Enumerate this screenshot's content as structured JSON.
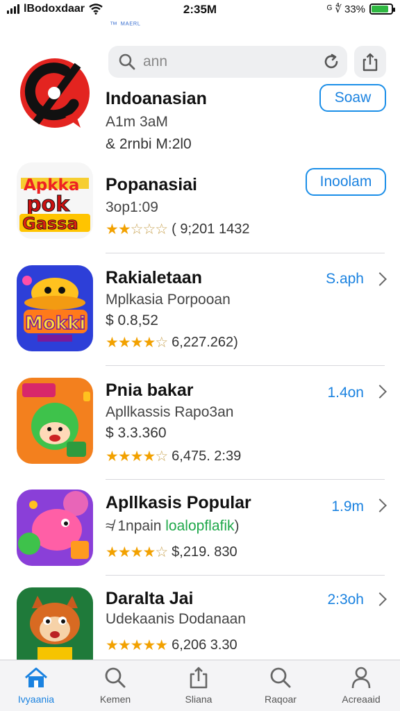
{
  "status_bar": {
    "carrier": "lBodoxdaar",
    "time": "2:35M",
    "right_text": "ᴳ ∜ 33%",
    "battery_level": 0.85,
    "sub_text": "™ ᴹᴬᴱᴿᴸ"
  },
  "search": {
    "value": "ann",
    "placeholder": "ann"
  },
  "apps": [
    {
      "name": "Indoanasian",
      "subtitle": "A1m 3aM",
      "meta": "& 2rnbi M:2l0",
      "action_label": "Soaw"
    },
    {
      "name": "Popanasiai",
      "subtitle": "3op1:09",
      "rating_text": "( 9;201 1432",
      "stars": 2.5,
      "action_label": "Inoolam"
    },
    {
      "name": "Rakialetaan",
      "subtitle": "Mplkasia Porpooan",
      "meta": "$ 0.8,52",
      "rating_text": "6,227.262)",
      "stars": 4.5,
      "size": "S.aph"
    },
    {
      "name": "Pnia bakar",
      "subtitle": "Apllkassis Rapo3an",
      "meta": "$ 3.3.360",
      "rating_text": "6,475. 2:39",
      "stars": 4.5,
      "size": "1.4on"
    },
    {
      "name": "Apllkasis Popular",
      "subtitle_prefix": "≉ 1npain",
      "subtitle_highlight": "loalopflafik",
      "subtitle_suffix": ")",
      "rating_text": "$,219. 830",
      "stars": 4,
      "size": "1.9m"
    },
    {
      "name": "Daralta Jai",
      "subtitle": "Udekaanis Dodanaan",
      "rating_text": "6,206 3.30",
      "stars": 5,
      "size": "2:3oh"
    }
  ],
  "tabs": [
    {
      "label": "Ivyaania",
      "icon": "home-icon",
      "active": true
    },
    {
      "label": "Kemen",
      "icon": "search-icon",
      "active": false
    },
    {
      "label": "Sliana",
      "icon": "share-icon",
      "active": false
    },
    {
      "label": "Raqoar",
      "icon": "search-icon",
      "active": false
    },
    {
      "label": "Acreaaid",
      "icon": "person-icon",
      "active": false
    }
  ],
  "colors": {
    "accent": "#1a82e0",
    "star": "#f2a100",
    "battery": "#2fb842"
  }
}
